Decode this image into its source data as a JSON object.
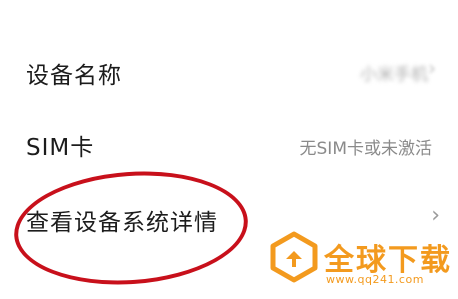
{
  "settings": {
    "device_name": {
      "label": "设备名称",
      "value": "小米手机"
    },
    "sim": {
      "label": "SIM卡",
      "value": "无SIM卡或未激活"
    },
    "system_details": {
      "label": "查看设备系统详情"
    }
  },
  "chevron_glyph": "›",
  "watermark": {
    "title": "全球下载",
    "url": "www.qq241.com",
    "color": "#f39a1e"
  },
  "annotation": {
    "shape": "ellipse",
    "color": "#c8101b",
    "target": "system_details"
  }
}
